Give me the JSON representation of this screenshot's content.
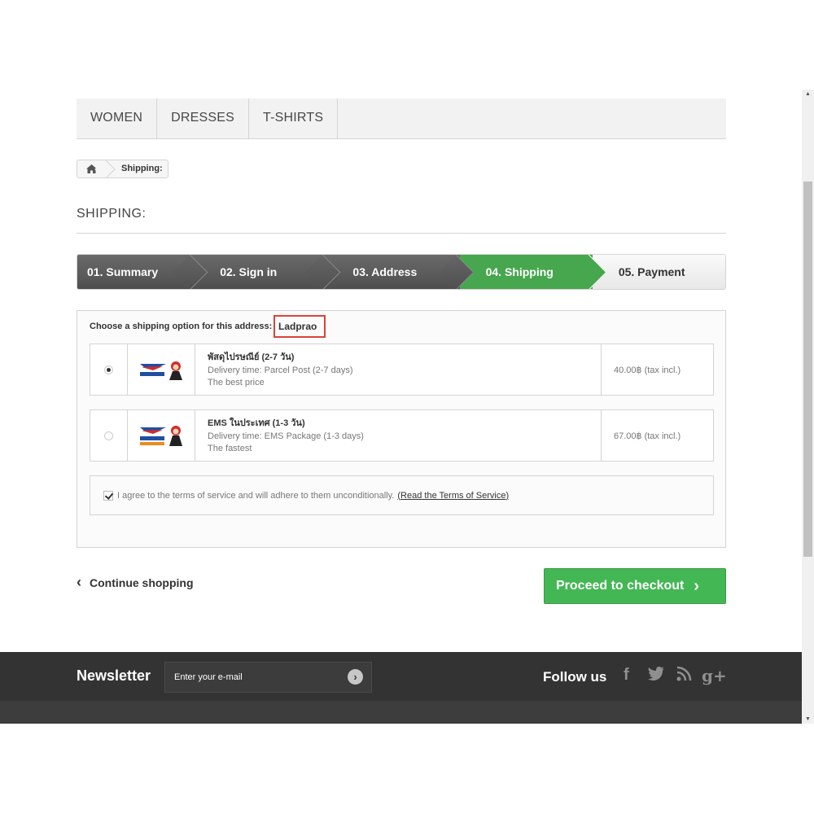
{
  "menu": {
    "items": [
      "WOMEN",
      "DRESSES",
      "T-SHIRTS"
    ]
  },
  "breadcrumb": {
    "home_icon": "home-icon",
    "current": "Shipping:"
  },
  "page": {
    "heading": "SHIPPING:"
  },
  "steps": [
    "01. Summary",
    "02. Sign in",
    "03. Address",
    "04. Shipping",
    "05. Payment"
  ],
  "shipping": {
    "prompt": "Choose a shipping option for this address:",
    "address": "Ladprao",
    "options": [
      {
        "name": "พัสดุไปรษณีย์ (2-7 วัน)",
        "delivery": "Delivery time: Parcel Post (2-7 days)",
        "note": "The best price",
        "price": "40.00฿ (tax incl.)",
        "selected": true
      },
      {
        "name": "EMS ในประเทศ (1-3 วัน)",
        "delivery": "Delivery time: EMS Package (1-3 days)",
        "note": "The fastest",
        "price": "67.00฿ (tax incl.)",
        "selected": false
      }
    ],
    "terms_text": "I agree to the terms of service and will adhere to them unconditionally.",
    "terms_link": "(Read the Terms of Service)"
  },
  "actions": {
    "continue": "Continue shopping",
    "checkout": "Proceed to checkout"
  },
  "footer": {
    "newsletter_title": "Newsletter",
    "newsletter_placeholder": "Enter your e-mail",
    "follow_title": "Follow us",
    "social": [
      "f",
      "t",
      "rss",
      "g+"
    ]
  },
  "colors": {
    "accent_green": "#46a74e",
    "checkout_green": "#43b754",
    "highlight_red": "#d9443b",
    "footer_bg": "#333333"
  }
}
